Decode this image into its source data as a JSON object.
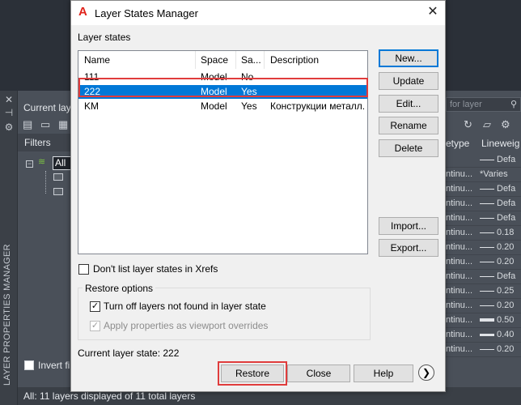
{
  "background": {
    "current_layer_label": "Current lay",
    "filters_label": "Filters",
    "tree_all": "All",
    "search_placeholder": "for layer",
    "vertical_title": "LAYER PROPERTIES MANAGER",
    "invert_filter_label": "Invert fi",
    "status_text": "All: 11 layers displayed of 11 total layers",
    "columns": {
      "linetype": "etype",
      "lineweight": "Lineweig"
    },
    "rows": [
      {
        "linetype": "",
        "lineweight": "Defa",
        "line": true
      },
      {
        "linetype": "ntinu...",
        "lineweight": "*Varies",
        "line": false
      },
      {
        "linetype": "ntinu...",
        "lineweight": "Defa",
        "line": true
      },
      {
        "linetype": "ntinu...",
        "lineweight": "Defa",
        "line": true
      },
      {
        "linetype": "ntinu...",
        "lineweight": "Defa",
        "line": true
      },
      {
        "linetype": "ntinu...",
        "lineweight": "0.18",
        "line": true
      },
      {
        "linetype": "ntinu...",
        "lineweight": "0.20",
        "line": true
      },
      {
        "linetype": "ntinu...",
        "lineweight": "0.20",
        "line": true
      },
      {
        "linetype": "ntinu...",
        "lineweight": "Defa",
        "line": true
      },
      {
        "linetype": "ntinu...",
        "lineweight": "0.25",
        "line": true
      },
      {
        "linetype": "ntinu...",
        "lineweight": "0.20",
        "line": true
      },
      {
        "linetype": "ntinu...",
        "lineweight": "0.50",
        "line": true
      },
      {
        "linetype": "ntinu...",
        "lineweight": "0.40",
        "line": true
      },
      {
        "linetype": "ntinu...",
        "lineweight": "0.20",
        "line": true
      }
    ]
  },
  "dialog": {
    "title": "Layer States Manager",
    "app_logo": "A",
    "close_glyph": "✕",
    "layer_states_label": "Layer states",
    "columns": [
      "Name",
      "Space",
      "Sa...",
      "Description"
    ],
    "states": [
      {
        "name": "111",
        "space": "Model",
        "saved": "No",
        "description": ""
      },
      {
        "name": "222",
        "space": "Model",
        "saved": "Yes",
        "description": ""
      },
      {
        "name": "KM",
        "space": "Model",
        "saved": "Yes",
        "description": "Конструкции металл..."
      }
    ],
    "selected_index": 1,
    "buttons": {
      "new": "New...",
      "update": "Update",
      "edit": "Edit...",
      "rename": "Rename",
      "delete": "Delete",
      "import": "Import...",
      "export": "Export...",
      "restore": "Restore",
      "close": "Close",
      "help": "Help"
    },
    "dont_list_xrefs": {
      "label": "Don't list layer states in Xrefs",
      "checked": false
    },
    "restore_options": {
      "legend": "Restore options",
      "turn_off": {
        "label": "Turn off layers not found in layer state",
        "checked": true
      },
      "apply_viewport": {
        "label": "Apply properties as viewport overrides",
        "checked": true,
        "disabled": true
      }
    },
    "current_state": "Current layer state: 222",
    "more_glyph": "❯",
    "highlight_color": "#e03c3c",
    "selection_color": "#0078d7"
  }
}
